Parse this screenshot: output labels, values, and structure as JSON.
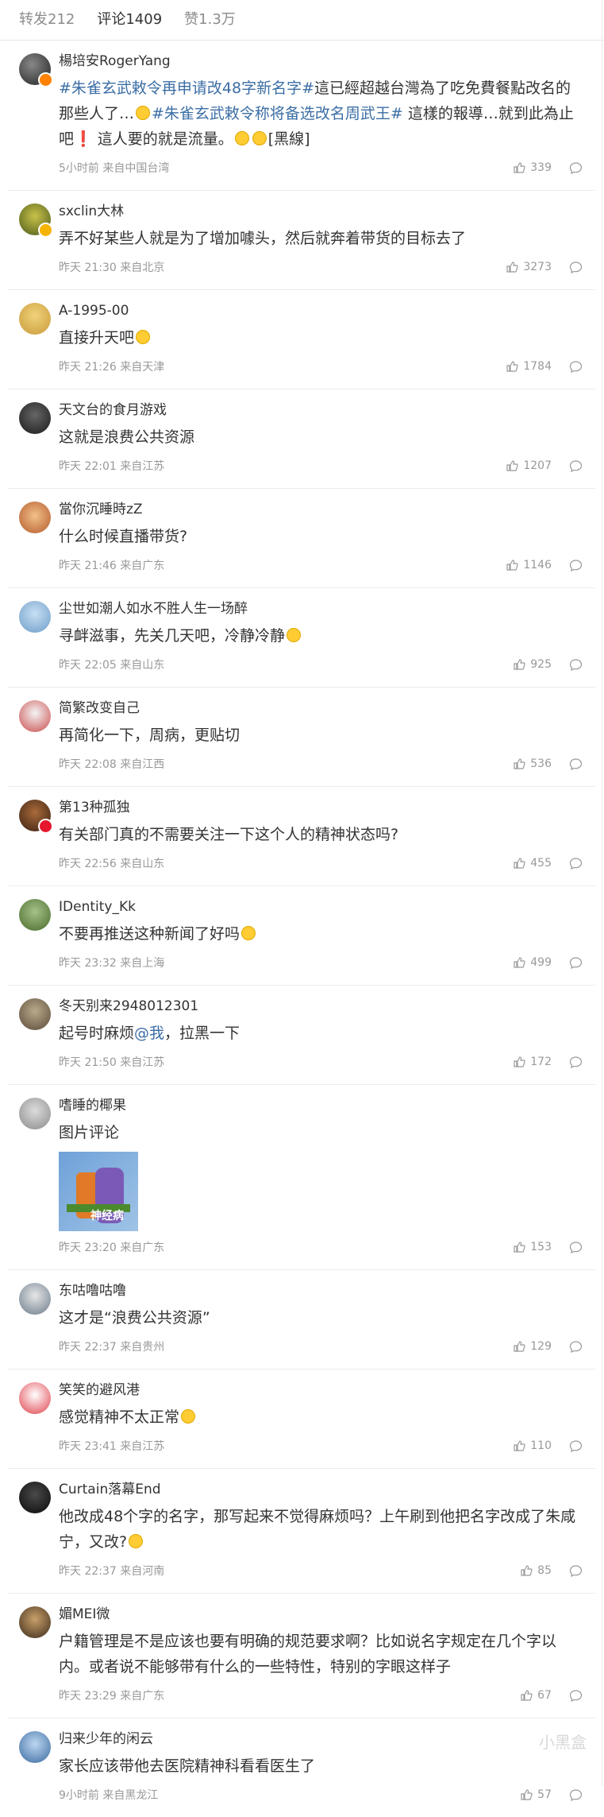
{
  "tabs": [
    {
      "label": "转发212"
    },
    {
      "label": "评论1409"
    },
    {
      "label": "赞1.3万"
    }
  ],
  "comments": [
    {
      "name": "楊培安RogerYang",
      "time": "5小时前 来自中国台湾",
      "likes": "339",
      "text_parts": [
        "#朱雀玄武敕令再申请改48字新名字#",
        "這已經超越台灣為了吃免費餐點改名的那些人了…",
        "#朱雀玄武敕令称将备选改名周武王#",
        " 這樣的報導…就到此為止吧",
        "❗",
        " 這人要的就是流量。",
        "[黑線]"
      ]
    },
    {
      "name": "sxclin大林",
      "time": "昨天 21:30 来自北京",
      "likes": "3273",
      "text": "弄不好某些人就是为了增加噱头，然后就奔着带货的目标去了"
    },
    {
      "name": "A-1995-00",
      "time": "昨天 21:26 来自天津",
      "likes": "1784",
      "text": "直接升天吧"
    },
    {
      "name": "天文台的食月游戏",
      "time": "昨天 22:01 来自江苏",
      "likes": "1207",
      "text": "这就是浪费公共资源"
    },
    {
      "name": "當你沉睡時zZ",
      "time": "昨天 21:46 来自广东",
      "likes": "1146",
      "text": "什么时候直播带货?"
    },
    {
      "name": "尘世如潮人如水不胜人生一场醉",
      "time": "昨天 22:05 来自山东",
      "likes": "925",
      "text": "寻衅滋事，先关几天吧，冷静冷静"
    },
    {
      "name": "简繁改变自己",
      "time": "昨天 22:08 来自江西",
      "likes": "536",
      "text": "再简化一下，周病，更贴切"
    },
    {
      "name": "第13种孤独",
      "time": "昨天 22:56 来自山东",
      "likes": "455",
      "text": "有关部门真的不需要关注一下这个人的精神状态吗?"
    },
    {
      "name": "IDentity_Kk",
      "time": "昨天 23:32 来自上海",
      "likes": "499",
      "text": "不要再推送这种新闻了好吗"
    },
    {
      "name": "冬天别来2948012301",
      "time": "昨天 21:50 来自江苏",
      "likes": "172",
      "text_a": "起号时麻烦",
      "mention": "@我",
      "text_b": "，拉黑一下"
    },
    {
      "name": "嗜睡的椰果",
      "time": "昨天 23:20 来自广东",
      "likes": "153",
      "text": "图片评论",
      "pic_caption": "神经病"
    },
    {
      "name": "东咕噜咕噜",
      "time": "昨天 22:37 来自贵州",
      "likes": "129",
      "text": "这才是“浪费公共资源”"
    },
    {
      "name": "笑笑的避风港",
      "time": "昨天 23:41 来自江苏",
      "likes": "110",
      "text": "感觉精神不太正常"
    },
    {
      "name": "Curtain落幕End",
      "time": "昨天 22:37 来自河南",
      "likes": "85",
      "text": "他改成48个字的名字，那写起来不觉得麻烦吗？上午刷到他把名字改成了朱咸宁，又改?"
    },
    {
      "name": "媚MEI微",
      "time": "昨天 23:29 来自广东",
      "likes": "67",
      "text": "户籍管理是不是应该也要有明确的规范要求啊？比如说名字规定在几个字以内。或者说不能够带有什么的一些特性，特别的字眼这样子"
    },
    {
      "name": "归来少年的闲云",
      "time": "9小时前 来自黑龙江",
      "likes": "57",
      "text": "家长应该带他去医院精神科看看医生了"
    }
  ],
  "watermark": "小黑盒"
}
